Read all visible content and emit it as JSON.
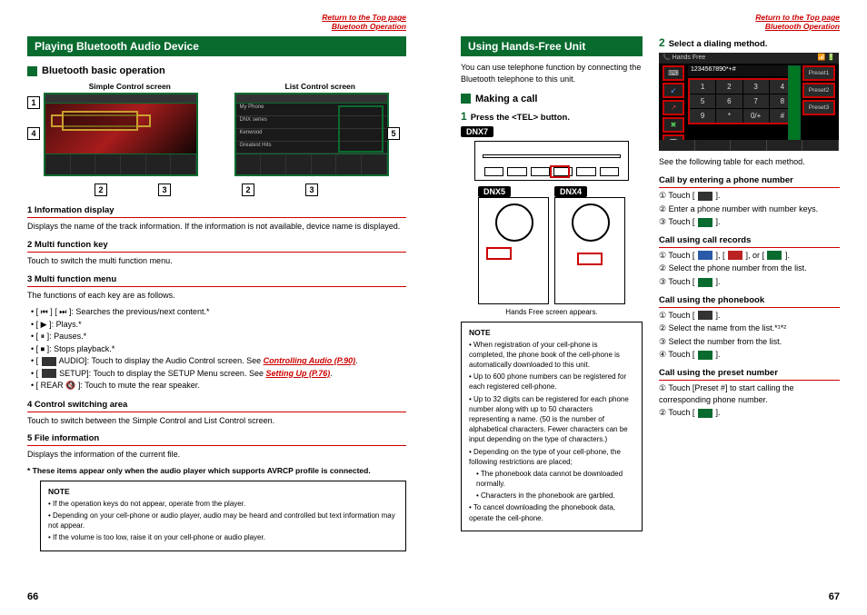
{
  "topLink": {
    "line1": "Return to the Top page",
    "line2": "Bluetooth Operation"
  },
  "left": {
    "h1": "Playing Bluetooth Audio Device",
    "h2": "Bluetooth basic operation",
    "screenLabels": {
      "simple": "Simple Control screen",
      "list": "List Control screen"
    },
    "callouts": {
      "c1": "1",
      "c2": "2",
      "c3": "3",
      "c4": "4",
      "c5": "5"
    },
    "sub1": {
      "head": "1  Information display",
      "body": "Displays the name of the track information. If the information is not available, device name is displayed."
    },
    "sub2": {
      "head": "2  Multi function key",
      "body": "Touch to switch the multi function menu."
    },
    "sub3": {
      "head": "3  Multi function menu",
      "intro": "The functions of each key are as follows.",
      "b1": "[ ⏮ ] [ ⏭ ]: Searches the previous/next content.*",
      "b2": "[ ▶ ]: Plays.*",
      "b3": "[ ⏸ ]: Pauses.*",
      "b4": "[ ⏹ ]: Stops playback.*",
      "b5a": "[ ",
      "b5b": " AUDIO]: Touch to display the Audio Control screen. See ",
      "b5link": "Controlling Audio (P.90)",
      "b5c": ".",
      "b6a": "[ ",
      "b6b": " SETUP]: Touch to display the SETUP Menu screen. See ",
      "b6link": "Setting Up (P.76)",
      "b6c": ".",
      "b7": "[ REAR 🔇 ]: Touch to mute the rear speaker."
    },
    "sub4": {
      "head": "4  Control switching area",
      "body": "Touch to switch between the Simple Control and List Control screen."
    },
    "sub5": {
      "head": "5  File information",
      "body": "Displays the information of the current file."
    },
    "footnote": "* These items appear only when the audio player which supports AVRCP profile is connected.",
    "note": {
      "title": "NOTE",
      "n1": "If the operation keys do not appear, operate from the player.",
      "n2": "Depending on your cell-phone or audio player, audio may be heard and controlled but text information may not appear.",
      "n3": "If the volume is too low, raise it on your cell-phone or audio player."
    },
    "pageNum": "66"
  },
  "right": {
    "h1": "Using Hands-Free Unit",
    "intro": "You can use telephone function by connecting the Bluetooth telephone to this unit.",
    "h2": "Making a call",
    "step1": "Press the <TEL> button.",
    "models": {
      "m7": "DNX7",
      "m5": "DNX5",
      "m4": "DNX4"
    },
    "caption": "Hands Free screen appears.",
    "note": {
      "title": "NOTE",
      "n1": "When registration of your cell-phone is completed, the phone book of the cell-phone is automatically downloaded to this unit.",
      "n2": "Up to 600 phone numbers can be registered for each registered cell-phone.",
      "n3": "Up to 32 digits can be registered for each phone number along with up to 50 characters representing a name. (50 is the number of alphabetical characters. Fewer characters can be input depending on the type of characters.)",
      "n4": "Depending on the type of your cell-phone, the following restrictions are placed;",
      "n5": "The phonebook data cannot be downloaded normally.",
      "n6": "Characters in the phonebook are garbled.",
      "n7": "To cancel downloading the phonebook data, operate the cell-phone."
    },
    "step2": "Select a dialing method.",
    "hf": {
      "title": "Hands Free",
      "display": "1234567890*+#",
      "presets": {
        "p1": "Preset1",
        "p2": "Preset2",
        "p3": "Preset3"
      },
      "keys": [
        "1",
        "2",
        "3",
        "4",
        "5",
        "6",
        "7",
        "8",
        "9",
        "*",
        "0/+",
        "#"
      ]
    },
    "tableIntro": "See the following table for each method.",
    "m1": {
      "head": "Call by entering a phone number",
      "l1a": "① Touch [ ",
      "l1b": " ].",
      "l2": "② Enter a phone number with number keys.",
      "l3a": "③ Touch [ ",
      "l3b": " ]."
    },
    "m2": {
      "head": "Call using call records",
      "l1a": "① Touch [ ",
      "l1b": " ], [ ",
      "l1c": " ], or [ ",
      "l1d": " ].",
      "l2": "② Select the phone number from the list.",
      "l3a": "③ Touch [ ",
      "l3b": " ]."
    },
    "m3": {
      "head": "Call using the phonebook",
      "l1a": "① Touch [ ",
      "l1b": " ].",
      "l2": "② Select the name from the list.*¹*²",
      "l3": "③ Select the number from the list.",
      "l4a": "④ Touch [ ",
      "l4b": " ]."
    },
    "m4": {
      "head": "Call using the preset number",
      "l1": "① Touch [Preset #] to start calling the corresponding phone number.",
      "l2a": "② Touch [ ",
      "l2b": " ]."
    },
    "pageNum": "67"
  }
}
